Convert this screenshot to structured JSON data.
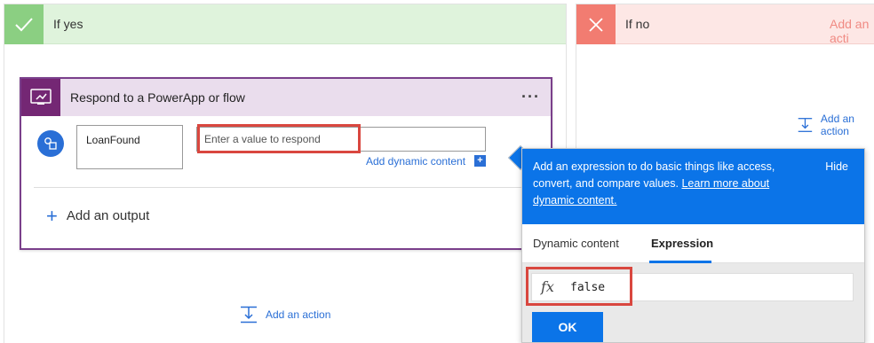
{
  "yes_branch": {
    "title": "If yes",
    "card": {
      "title": "Respond to a PowerApp or flow",
      "menu": "···",
      "output_name": "LoanFound",
      "value_placeholder": "Enter a value to respond",
      "dynamic_content_link": "Add dynamic content",
      "dynamic_plus": "+",
      "add_output": "Add an output"
    },
    "add_action": "Add an action"
  },
  "no_branch": {
    "title": "If no",
    "add_action_partial": "Add an action",
    "faded_title": "Add an acti"
  },
  "expression_popover": {
    "banner_text": "Add an expression to do basic things like access, convert, and compare values.",
    "learn_more": "Learn more about dynamic content.",
    "hide": "Hide",
    "tabs": [
      "Dynamic content",
      "Expression"
    ],
    "active_tab": "Expression",
    "fx_symbol": "fx",
    "expression_value": "false",
    "ok_label": "OK"
  },
  "colors": {
    "yes_header": "#dff3dc",
    "yes_accent": "#8bcf82",
    "no_header": "#fde7e5",
    "no_accent": "#f27c71",
    "card_accent": "#742774",
    "link_blue": "#2a6fd6",
    "popover_blue": "#0b74e8",
    "highlight_red": "#d9473f"
  }
}
